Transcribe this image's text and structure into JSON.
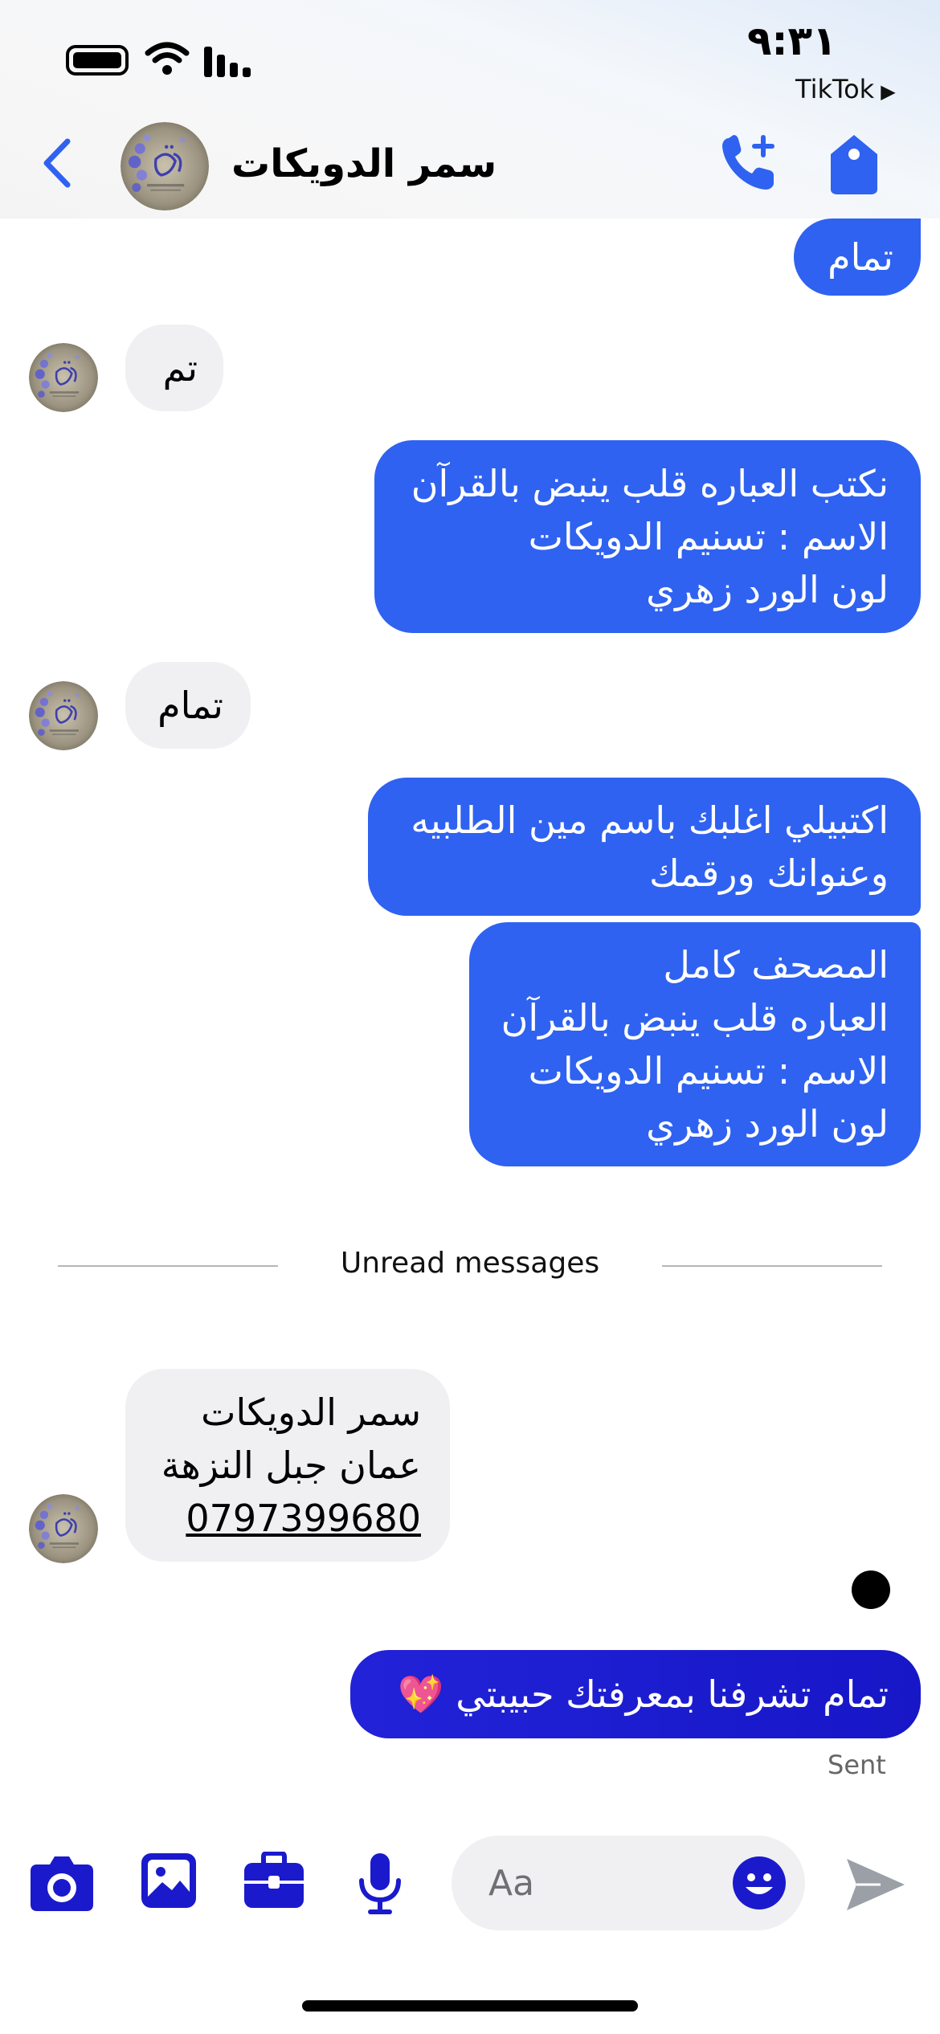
{
  "status_bar": {
    "time": "٩:٣١",
    "back_app": "TikTok",
    "back_app_arrow": "▶"
  },
  "header": {
    "contact_name": "سمر الدويكات",
    "back_icon": "chevron-left-icon",
    "call_icon": "phone-plus-icon",
    "tag_icon": "tag-icon"
  },
  "colors": {
    "accent": "#2f62f0",
    "outgoing_bubble": "#2f62f0",
    "incoming_bubble": "#f0f0f2",
    "last_bubble": "#1a1acc"
  },
  "messages": [
    {
      "dir": "out",
      "lines": [
        "تمام"
      ]
    },
    {
      "dir": "in",
      "lines": [
        "تم"
      ]
    },
    {
      "dir": "out",
      "lines": [
        "نكتب العباره قلب ينبض بالقرآن",
        "الاسم : تسنيم الدويكات",
        "لون الورد زهري"
      ]
    },
    {
      "dir": "in",
      "lines": [
        "تمام"
      ]
    },
    {
      "dir": "out",
      "lines": [
        "اكتبيلي اغلبك باسم مين الطلبيه",
        "وعنوانك ورقمك"
      ]
    },
    {
      "dir": "out",
      "lines": [
        "المصحف كامل",
        "العباره قلب ينبض بالقرآن",
        "الاسم : تسنيم الدويكات",
        "لون الورد زهري"
      ]
    },
    {
      "dir": "in",
      "lines": [
        "سمر الدويكات",
        "عمان جبل النزهة",
        "0797399680"
      ]
    },
    {
      "dir": "out",
      "lines": [
        "تمام تشرفنا بمعرفتك حبيبتي 💖"
      ]
    }
  ],
  "unread_divider": "Unread messages",
  "sent_status": "Sent",
  "composer": {
    "placeholder": "Aa",
    "icons": [
      "camera-icon",
      "gallery-icon",
      "briefcase-icon",
      "microphone-icon",
      "emoji-icon",
      "send-icon"
    ]
  }
}
